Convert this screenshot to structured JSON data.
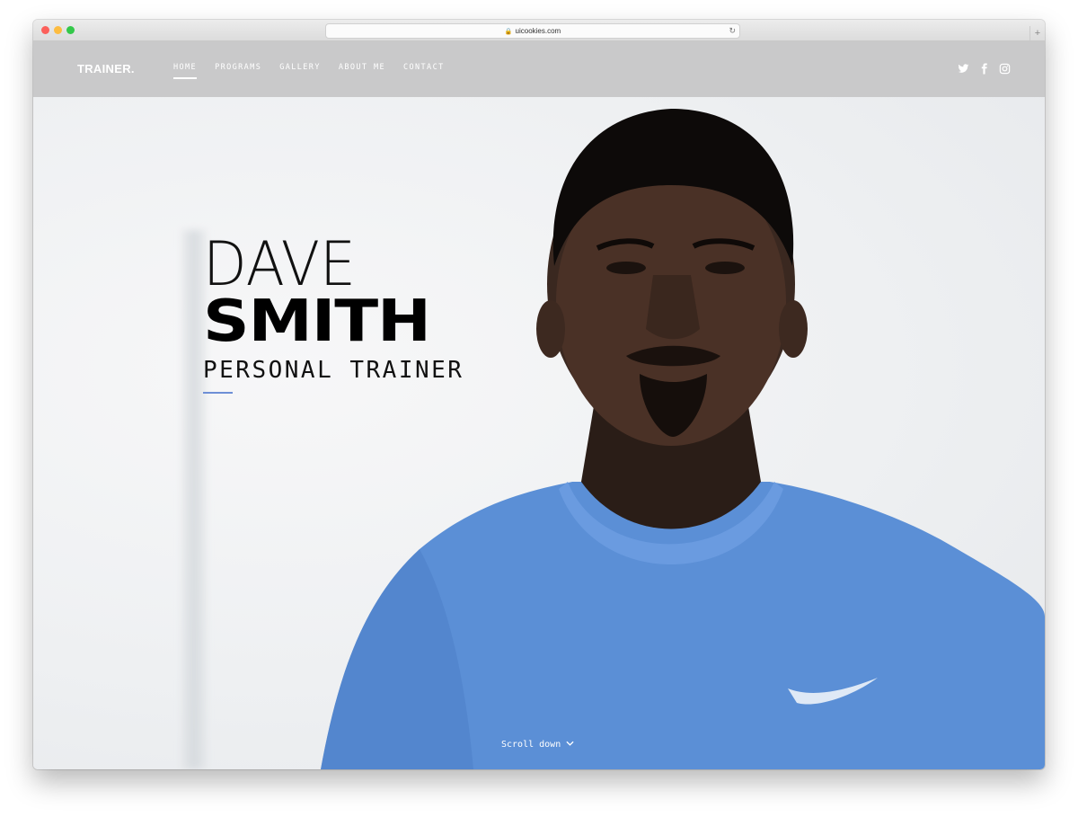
{
  "browser": {
    "url": "uicookies.com",
    "lock_icon": "lock-icon",
    "reload_icon": "reload-icon",
    "newtab_icon": "plus-icon"
  },
  "site": {
    "logo": "TRAINER.",
    "nav": [
      {
        "label": "HOME",
        "active": true
      },
      {
        "label": "PROGRAMS",
        "active": false
      },
      {
        "label": "GALLERY",
        "active": false
      },
      {
        "label": "ABOUT ME",
        "active": false
      },
      {
        "label": "CONTACT",
        "active": false
      }
    ],
    "social": [
      "twitter-icon",
      "facebook-icon",
      "instagram-icon"
    ]
  },
  "hero": {
    "first_name": "DAVE",
    "last_name": "SMITH",
    "role": "PERSONAL TRAINER",
    "scroll_label": "Scroll down",
    "scroll_icon": "chevron-down-icon",
    "shirt_brand": "NIKE"
  },
  "colors": {
    "header_bg": "#c9c9ca",
    "accent": "#6e8fd6",
    "shirt": "#5b8fd6"
  }
}
